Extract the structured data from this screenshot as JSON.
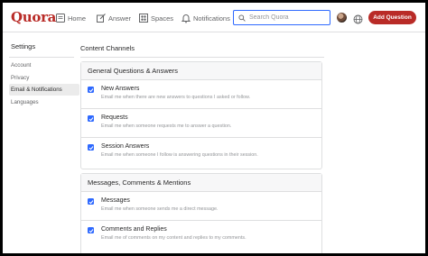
{
  "header": {
    "logo": "Quora",
    "nav": [
      {
        "label": "Home",
        "icon": "home-icon"
      },
      {
        "label": "Answer",
        "icon": "answer-icon"
      },
      {
        "label": "Spaces",
        "icon": "spaces-icon"
      },
      {
        "label": "Notifications",
        "icon": "bell-icon"
      }
    ],
    "search_placeholder": "Search Quora",
    "search_value": "",
    "add_question_label": "Add Question",
    "brand_color": "#b92b27",
    "accent_color": "#2e69ff"
  },
  "sidebar": {
    "title": "Settings",
    "items": [
      {
        "label": "Account"
      },
      {
        "label": "Privacy"
      },
      {
        "label": "Email & Notifications",
        "active": true
      },
      {
        "label": "Languages"
      }
    ]
  },
  "main": {
    "title": "Content Channels",
    "sections": [
      {
        "heading": "General Questions & Answers",
        "options": [
          {
            "title": "New Answers",
            "desc": "Email me when there are new answers to questions I asked or follow.",
            "checked": true
          },
          {
            "title": "Requests",
            "desc": "Email me when someone requests me to answer a question.",
            "checked": true
          },
          {
            "title": "Session Answers",
            "desc": "Email me when someone I follow is answering questions in their session.",
            "checked": true
          }
        ]
      },
      {
        "heading": "Messages, Comments & Mentions",
        "options": [
          {
            "title": "Messages",
            "desc": "Email me when someone sends me a direct message.",
            "checked": true
          },
          {
            "title": "Comments and Replies",
            "desc": "Email me of comments on my content and replies to my comments.",
            "checked": true
          }
        ]
      }
    ]
  }
}
